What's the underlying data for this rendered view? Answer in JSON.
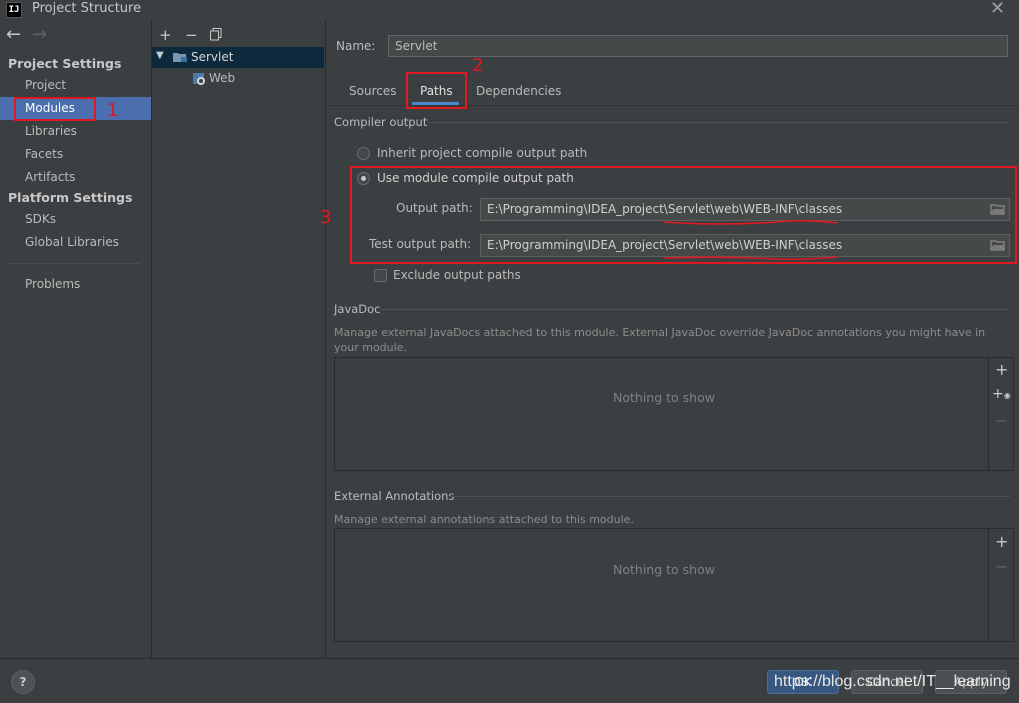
{
  "window": {
    "title": "Project Structure",
    "app_icon": "IJ"
  },
  "nav": {
    "back": "←",
    "forward": "→"
  },
  "sidebar": {
    "project_settings_header": "Project Settings",
    "project_items": [
      "Project",
      "Modules",
      "Libraries",
      "Facets",
      "Artifacts"
    ],
    "platform_settings_header": "Platform Settings",
    "platform_items": [
      "SDKs",
      "Global Libraries"
    ],
    "problems": "Problems",
    "selected": "Modules"
  },
  "tree": {
    "toolbar": {
      "add": "+",
      "remove": "−",
      "copy": "copy-icon"
    },
    "root": "Servlet",
    "child": "Web"
  },
  "module": {
    "name_label": "Name:",
    "name_value": "Servlet",
    "tabs": [
      "Sources",
      "Paths",
      "Dependencies"
    ],
    "active_tab": "Paths",
    "compiler_output": {
      "title": "Compiler output",
      "inherit_label": "Inherit project compile output path",
      "use_module_label": "Use module compile output path",
      "selected": "use_module",
      "output_path_label": "Output path:",
      "output_path_value": "E:\\Programming\\IDEA_project\\Servlet\\web\\WEB-INF\\classes",
      "test_output_path_label": "Test output path:",
      "test_output_path_value": "E:\\Programming\\IDEA_project\\Servlet\\web\\WEB-INF\\classes",
      "exclude_label": "Exclude output paths",
      "exclude_checked": false
    },
    "javadoc": {
      "title": "JavaDoc",
      "description": "Manage external JavaDocs attached to this module. External JavaDoc override JavaDoc annotations you might have in your module.",
      "empty_text": "Nothing to show"
    },
    "external_annotations": {
      "title": "External Annotations",
      "description": "Manage external annotations attached to this module.",
      "empty_text": "Nothing to show"
    }
  },
  "annotations": {
    "one": "1",
    "two": "2",
    "three": "3"
  },
  "bottom": {
    "help": "?",
    "ok": "OK",
    "cancel": "Cancel",
    "apply": "Apply"
  },
  "watermark": "https://blog.csdn.net/IT__learning",
  "colors": {
    "selection": "#4b6eaf",
    "annotation": "#e0181f",
    "background": "#3c3f41"
  }
}
